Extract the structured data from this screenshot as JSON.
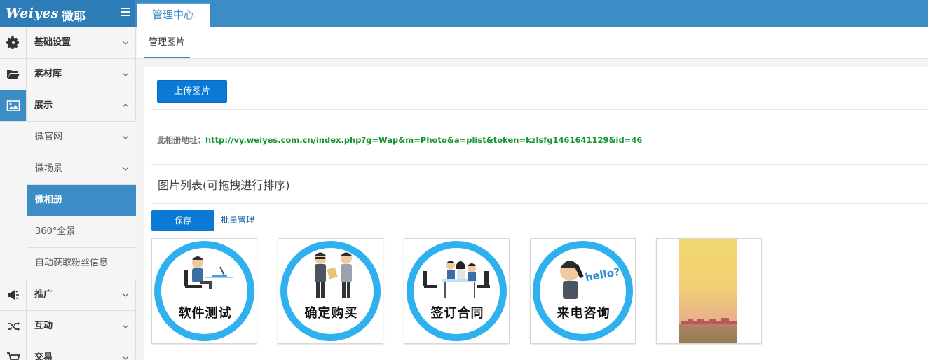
{
  "app": {
    "logo_latin": "Weiyes",
    "logo_cn": "微耶",
    "top_tab": "管理中心"
  },
  "sidebar": {
    "items": [
      {
        "label": "基础设置",
        "icon": "gear-icon"
      },
      {
        "label": "素材库",
        "icon": "folder-open-icon"
      },
      {
        "label": "展示",
        "icon": "image-icon"
      }
    ],
    "sub_items": [
      {
        "label": "微官网"
      },
      {
        "label": "微场景"
      },
      {
        "label": "微相册"
      },
      {
        "label": "360°全景"
      },
      {
        "label": "自动获取粉丝信息"
      }
    ],
    "bottom_items": [
      {
        "label": "推广",
        "icon": "megaphone-icon"
      },
      {
        "label": "互动",
        "icon": "shuffle-icon"
      },
      {
        "label": "交易",
        "icon": "cart-icon"
      }
    ]
  },
  "subheader": {
    "tab": "管理图片"
  },
  "main": {
    "upload_label": "上传图片",
    "address_label": "此相册地址：",
    "address_url": "http://vy.weiyes.com.cn/index.php?g=Wap&m=Photo&a=plist&token=kzlsfg1461641129&id=46",
    "list_title": "图片列表(可拖拽进行排序)",
    "save_label": "保存",
    "batch_label": "批量管理",
    "thumbnails": [
      {
        "caption": "软件测试"
      },
      {
        "caption": "确定购买"
      },
      {
        "caption": "签订合同"
      },
      {
        "caption": "来电咨询",
        "speech": "hello?"
      },
      {
        "caption": ""
      }
    ]
  },
  "colors": {
    "topbar": "#3c8dc6",
    "accent_button": "#0b7ad6",
    "badge_ring": "#2fb0ef",
    "url_green": "#14952d"
  }
}
